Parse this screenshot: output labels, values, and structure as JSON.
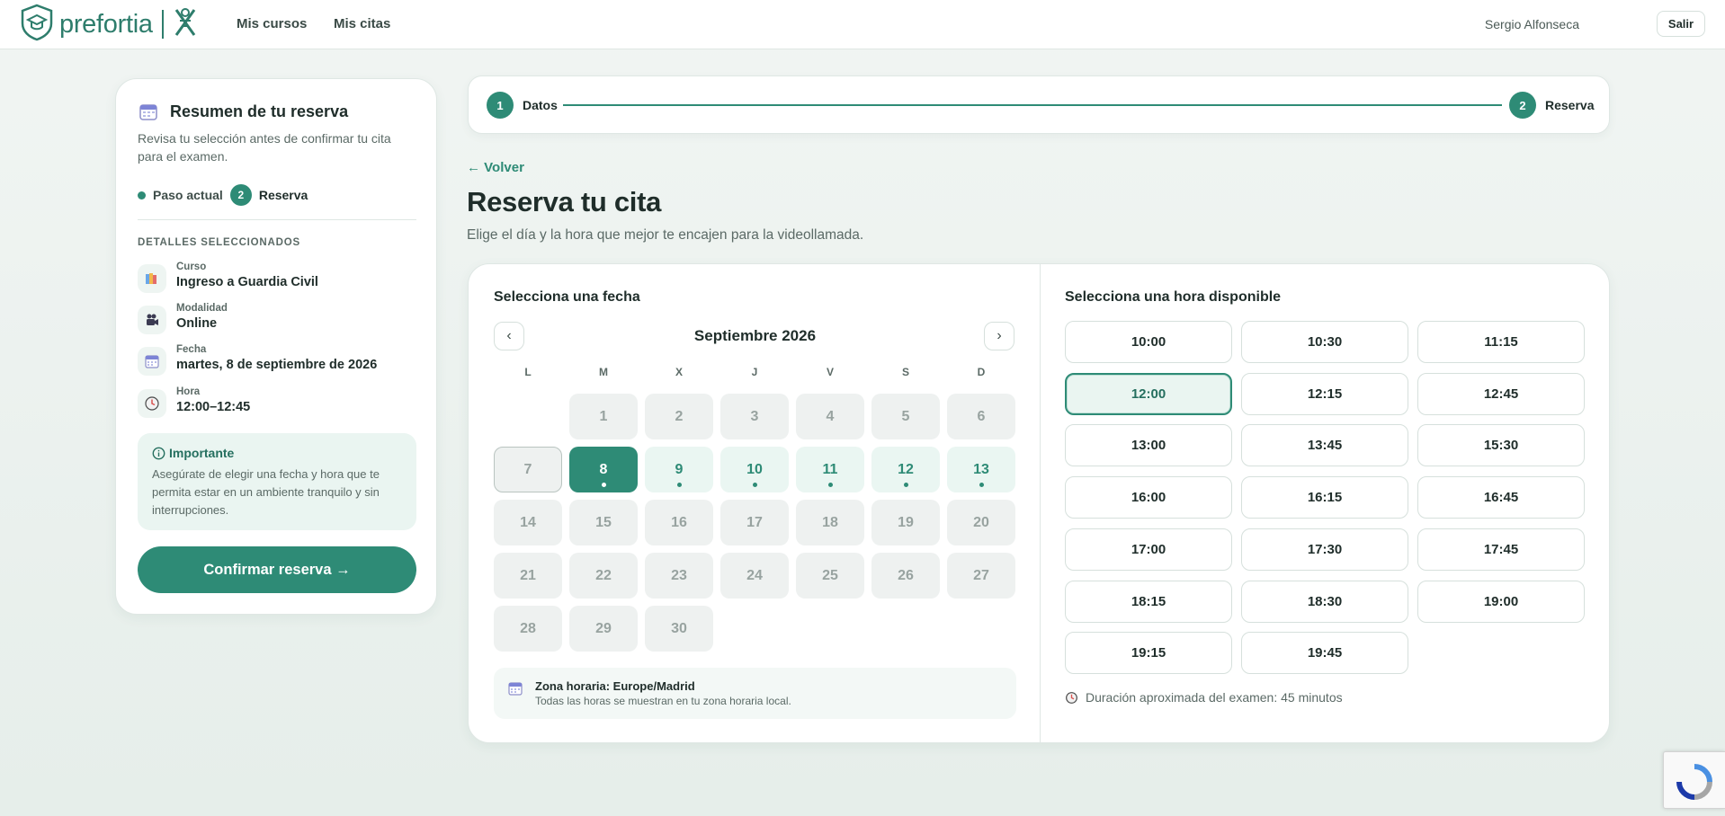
{
  "header": {
    "brand": "prefortia",
    "nav": [
      "Mis cursos",
      "Mis citas"
    ],
    "user_name": "Sergio Alfonseca",
    "logout_label": "Salir"
  },
  "summary": {
    "title": "Resumen de tu reserva",
    "description": "Revisa tu selección antes de confirmar tu cita para el examen.",
    "current_step_label": "Paso actual",
    "current_step_number": "2",
    "current_step_name": "Reserva",
    "details_heading": "DETALLES SELECCIONADOS",
    "details": [
      {
        "label": "Curso",
        "value": "Ingreso a Guardia Civil",
        "icon": "books-icon"
      },
      {
        "label": "Modalidad",
        "value": "Online",
        "icon": "video-camera-icon"
      },
      {
        "label": "Fecha",
        "value": "martes, 8 de septiembre de 2026",
        "icon": "calendar-icon"
      },
      {
        "label": "Hora",
        "value": "12:00–12:45",
        "icon": "clock-icon"
      }
    ],
    "important_title": "Importante",
    "important_text": "Asegúrate de elegir una fecha y hora que te permita estar en un ambiente tranquilo y sin interrupciones.",
    "confirm_label": "Confirmar reserva →"
  },
  "stepper": {
    "steps": [
      {
        "number": "1",
        "label": "Datos"
      },
      {
        "number": "2",
        "label": "Reserva"
      }
    ]
  },
  "page": {
    "back_label": "← Volver",
    "title": "Reserva tu cita",
    "subtitle": "Elige el día y la hora que mejor te encajen para la videollamada."
  },
  "calendar": {
    "section_title": "Selecciona una fecha",
    "month_label": "Septiembre 2026",
    "prev_label": "‹",
    "next_label": "›",
    "weekdays": [
      "L",
      "M",
      "X",
      "J",
      "V",
      "S",
      "D"
    ],
    "weeks": [
      [
        null,
        {
          "d": "1",
          "s": "na"
        },
        {
          "d": "2",
          "s": "na"
        },
        {
          "d": "3",
          "s": "na"
        },
        {
          "d": "4",
          "s": "na"
        },
        {
          "d": "5",
          "s": "na"
        },
        {
          "d": "6",
          "s": "na"
        }
      ],
      [
        {
          "d": "7",
          "s": "today"
        },
        {
          "d": "8",
          "s": "sel"
        },
        {
          "d": "9",
          "s": "avail"
        },
        {
          "d": "10",
          "s": "avail"
        },
        {
          "d": "11",
          "s": "avail"
        },
        {
          "d": "12",
          "s": "avail"
        },
        {
          "d": "13",
          "s": "avail"
        }
      ],
      [
        {
          "d": "14",
          "s": "na"
        },
        {
          "d": "15",
          "s": "na"
        },
        {
          "d": "16",
          "s": "na"
        },
        {
          "d": "17",
          "s": "na"
        },
        {
          "d": "18",
          "s": "na"
        },
        {
          "d": "19",
          "s": "na"
        },
        {
          "d": "20",
          "s": "na"
        }
      ],
      [
        {
          "d": "21",
          "s": "na"
        },
        {
          "d": "22",
          "s": "na"
        },
        {
          "d": "23",
          "s": "na"
        },
        {
          "d": "24",
          "s": "na"
        },
        {
          "d": "25",
          "s": "na"
        },
        {
          "d": "26",
          "s": "na"
        },
        {
          "d": "27",
          "s": "na"
        }
      ],
      [
        {
          "d": "28",
          "s": "na"
        },
        {
          "d": "29",
          "s": "na"
        },
        {
          "d": "30",
          "s": "na"
        },
        null,
        null,
        null,
        null
      ]
    ],
    "timezone_title": "Zona horaria: Europe/Madrid",
    "timezone_sub": "Todas las horas se muestran en tu zona horaria local."
  },
  "times": {
    "section_title": "Selecciona una hora disponible",
    "selected": "12:00",
    "slots": [
      "10:00",
      "10:30",
      "11:15",
      "12:00",
      "12:15",
      "12:45",
      "13:00",
      "13:45",
      "15:30",
      "16:00",
      "16:15",
      "16:45",
      "17:00",
      "17:30",
      "17:45",
      "18:15",
      "18:30",
      "19:00",
      "19:15",
      "19:45"
    ],
    "duration_text": "Duración aproximada del examen: 45 minutos"
  },
  "colors": {
    "accent": "#2e8b76",
    "accent_dark": "#256f5f",
    "text": "#1f2d2a",
    "muted": "#5b6a66"
  }
}
